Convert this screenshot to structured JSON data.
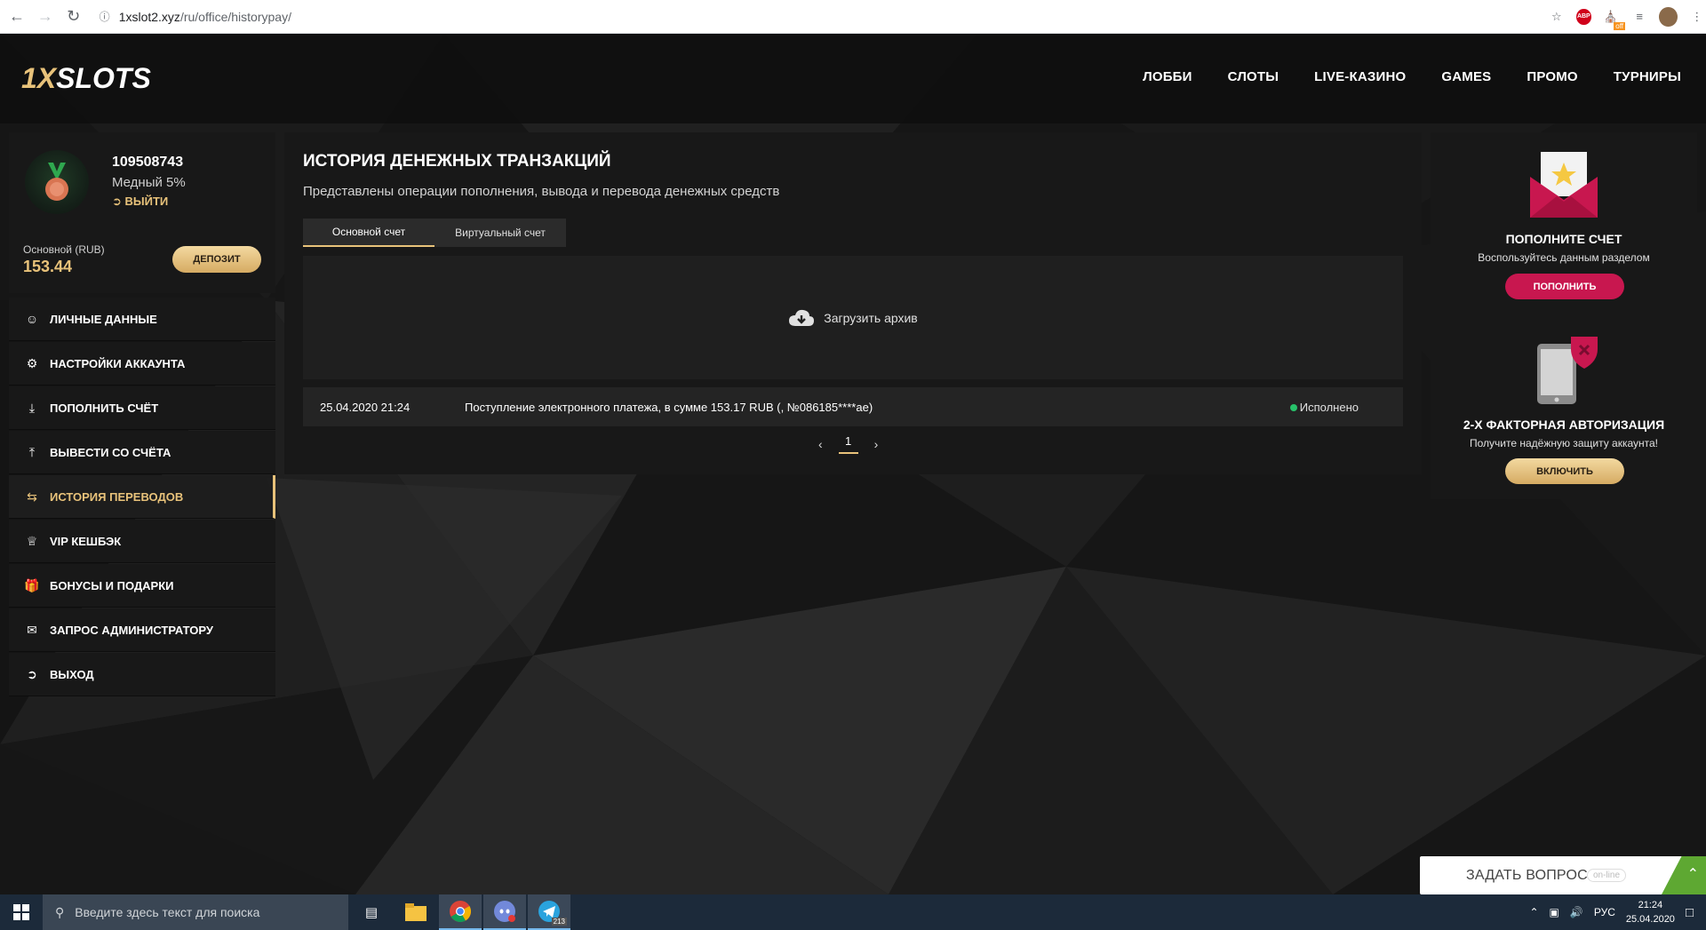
{
  "browser": {
    "url_host": "1xslot2.xyz",
    "url_path": "/ru/office/historypay/",
    "abp_label": "ABP",
    "ext_badge": "off"
  },
  "header": {
    "logo_prefix": "1X",
    "logo_suffix": "SLOTS",
    "nav": [
      "ЛОББИ",
      "СЛОТЫ",
      "LIVE-КАЗИНО",
      "GAMES",
      "ПРОМО",
      "ТУРНИРЫ"
    ]
  },
  "profile": {
    "user_id": "109508743",
    "level": "Медный 5%",
    "logout": "ВЫЙТИ",
    "account_label": "Основной (RUB)",
    "account_value": "153.44",
    "deposit_button": "ДЕПОЗИТ"
  },
  "side_menu": [
    {
      "label": "ЛИЧНЫЕ ДАННЫЕ",
      "icon": "user-edit-icon"
    },
    {
      "label": "НАСТРОЙКИ АККАУНТА",
      "icon": "gears-icon"
    },
    {
      "label": "ПОПОЛНИТЬ СЧЁТ",
      "icon": "download-icon"
    },
    {
      "label": "ВЫВЕСТИ СО СЧЁТА",
      "icon": "upload-icon"
    },
    {
      "label": "ИСТОРИЯ ПЕРЕВОДОВ",
      "icon": "exchange-icon",
      "active": true
    },
    {
      "label": "VIP КЕШБЭК",
      "icon": "crown-icon"
    },
    {
      "label": "БОНУСЫ И ПОДАРКИ",
      "icon": "gift-icon"
    },
    {
      "label": "ЗАПРОС АДМИНИСТРАТОРУ",
      "icon": "envelope-icon"
    },
    {
      "label": "ВЫХОД",
      "icon": "sign-out-icon"
    }
  ],
  "main": {
    "title": "ИСТОРИЯ ДЕНЕЖНЫХ ТРАНЗАКЦИЙ",
    "subtitle": "Представлены операции пополнения, вывода и перевода денежных средств",
    "tabs": [
      "Основной счет",
      "Виртуальный счет"
    ],
    "archive_button": "Загрузить архив",
    "transactions": [
      {
        "date": "25.04.2020 21:24",
        "description": "Поступление электронного платежа, в сумме 153.17 RUB (, №086185****ae)",
        "status": "Исполнено"
      }
    ],
    "pagination": {
      "prev": "‹",
      "page": "1",
      "next": "›"
    }
  },
  "widgets": {
    "deposit": {
      "title": "ПОПОЛНИТЕ СЧЕТ",
      "text": "Воспользуйтесь данным разделом",
      "button": "ПОПОЛНИТЬ"
    },
    "two_factor": {
      "title": "2-Х ФАКТОРНАЯ АВТОРИЗАЦИЯ",
      "text": "Получите надёжную защиту аккаунта!",
      "button": "ВКЛЮЧИТЬ"
    }
  },
  "ask": {
    "label": "ЗАДАТЬ ВОПРОС",
    "status": "on-line"
  },
  "taskbar": {
    "search_placeholder": "Введите здесь текст для поиска",
    "telegram_badge": "213",
    "language": "РУС",
    "time": "21:24",
    "date": "25.04.2020"
  },
  "colors": {
    "accent_gold": "#e8c27a",
    "pink": "#c8174f",
    "status_green": "#27c26a",
    "panel": "#181818"
  }
}
